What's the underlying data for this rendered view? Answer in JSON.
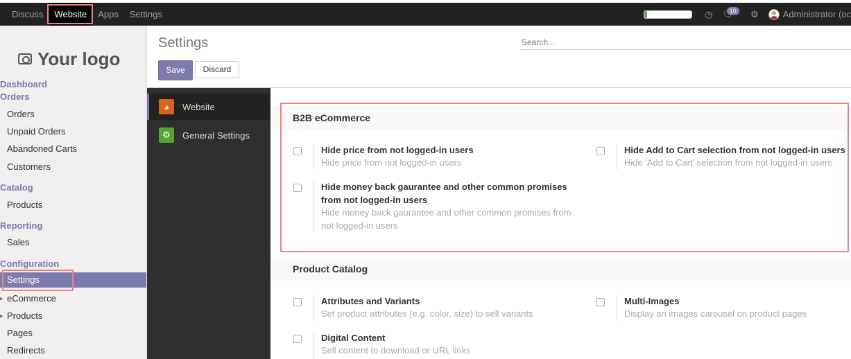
{
  "navbar": {
    "menus": [
      "Discuss",
      "Website",
      "Apps",
      "Settings"
    ],
    "active_menu": "Website",
    "progress": 0.06,
    "chat_count": "10",
    "user": "Administrator (oc"
  },
  "sidebar": {
    "logo_text": "Your logo",
    "dashboard": "Dashboard",
    "orders_section": "Orders",
    "orders_items": [
      "Orders",
      "Unpaid Orders",
      "Abandoned Carts",
      "Customers"
    ],
    "catalog_section": "Catalog",
    "catalog_items": [
      "Products"
    ],
    "reporting_section": "Reporting",
    "reporting_items": [
      "Sales"
    ],
    "configuration_section": "Configuration",
    "configuration_items": [
      "Settings",
      "eCommerce",
      "Products",
      "Pages",
      "Redirects"
    ]
  },
  "control": {
    "title": "Settings",
    "save_label": "Save",
    "discard_label": "Discard",
    "search_placeholder": "Search..."
  },
  "tabs": [
    "Website",
    "General Settings"
  ],
  "sections": {
    "b2b": {
      "title": "B2B eCommerce",
      "settings": [
        {
          "title": "Hide price from not logged-in users",
          "desc": "Hide price from not logged-in users"
        },
        {
          "title": "Hide Add to Cart selection from not logged-in users",
          "desc": "Hide 'Add to Cart' selection from not logged-in users"
        },
        {
          "title_line1": "Hide money back gaurantee and other common promises",
          "title_line2": "from not logged-in users",
          "desc_line1": "Hide money back gaurantee and other common promises from",
          "desc_line2": "not logged-in users"
        }
      ]
    },
    "catalog": {
      "title": "Product Catalog",
      "settings": [
        {
          "title": "Attributes and Variants",
          "desc": "Set product attributes (e.g. color, size) to sell variants"
        },
        {
          "title": "Multi-Images",
          "desc": "Display an images carousel on product pages"
        },
        {
          "title": "Digital Content",
          "desc": "Sell content to download or URL links"
        }
      ]
    }
  },
  "colors": {
    "brand": "#7c7bad",
    "navbar": "#222222",
    "highlight": "#f07f83",
    "progress": "#5cb85c"
  }
}
